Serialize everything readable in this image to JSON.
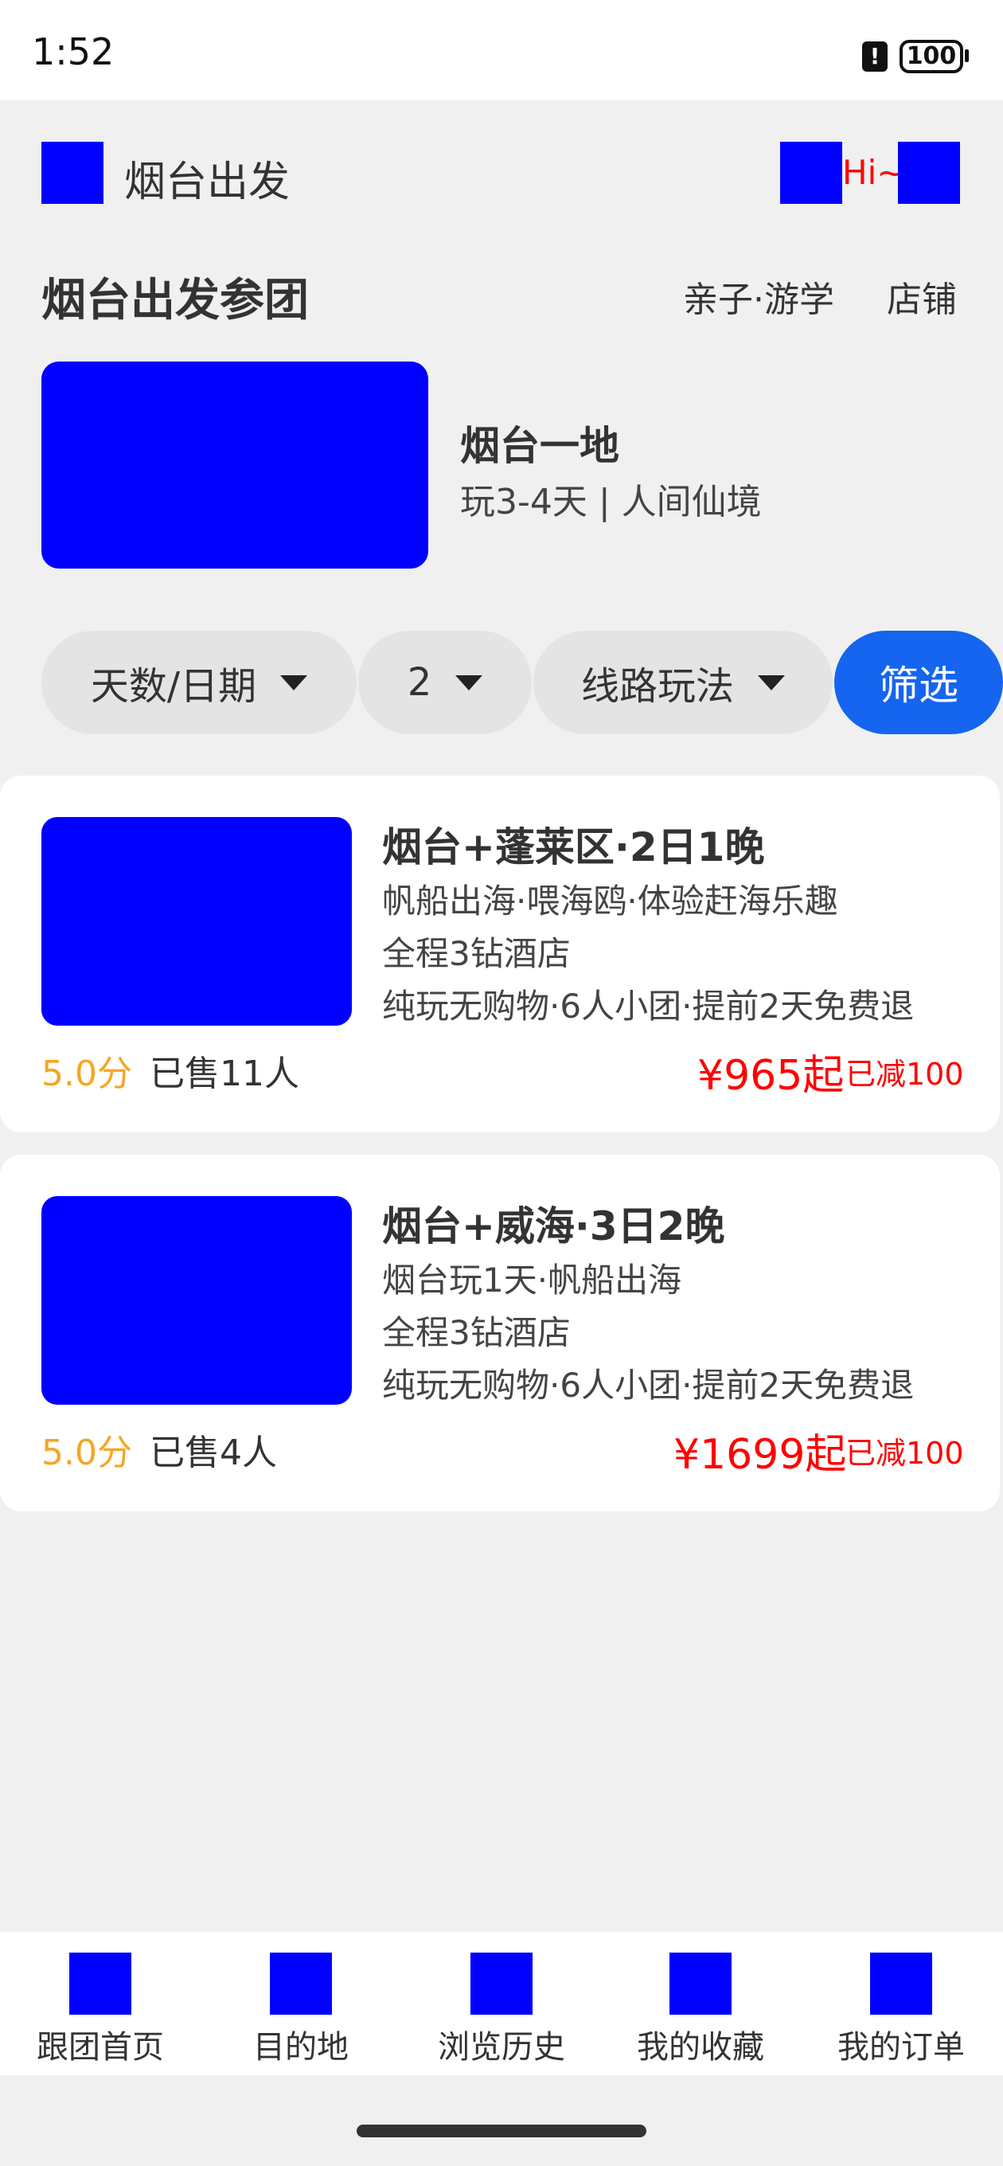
{
  "status_bar": {
    "time": "1:52",
    "battery": "100"
  },
  "header": {
    "title": "烟台出发",
    "greeting": "Hi~"
  },
  "section": {
    "title": "烟台出发参团",
    "link_family": "亲子·游学",
    "link_shop": "店铺"
  },
  "destination": {
    "name": "烟台一地",
    "desc": "玩3-4天 | 人间仙境"
  },
  "filters": {
    "days": "天数/日期",
    "count": "2",
    "route": "线路玩法",
    "filter_button": "筛选"
  },
  "products": [
    {
      "title": "烟台+蓬莱区·2日1晚",
      "line1": "帆船出海·喂海鸥·体验赶海乐趣",
      "line2": "全程3钻酒店",
      "line3": "纯玩无购物·6人小团·提前2天免费退",
      "score": "5.0分",
      "sold": "已售11人",
      "price": "¥965起",
      "discount": "已减100"
    },
    {
      "title": "烟台+威海·3日2晚",
      "line1": "烟台玩1天·帆船出海",
      "line2": "全程3钻酒店",
      "line3": "纯玩无购物·6人小团·提前2天免费退",
      "score": "5.0分",
      "sold": "已售4人",
      "price": "¥1699起",
      "discount": "已减100"
    }
  ],
  "nav": [
    {
      "label": "跟团首页"
    },
    {
      "label": "目的地"
    },
    {
      "label": "浏览历史"
    },
    {
      "label": "我的收藏"
    },
    {
      "label": "我的订单"
    }
  ],
  "colors": {
    "accent": "#1565f0",
    "price": "#ff0000",
    "score": "#f5a623",
    "placeholder": "#0000ff"
  }
}
